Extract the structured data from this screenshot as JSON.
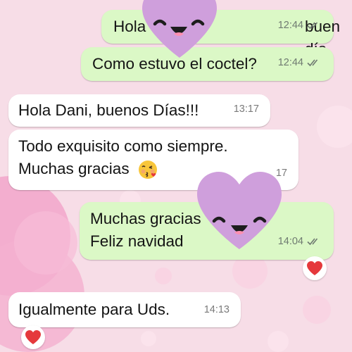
{
  "colors": {
    "background": "#f7dde7",
    "outgoing_bubble": "#dbf8c6",
    "incoming_bubble": "#ffffff",
    "meta_text": "#6f7a71",
    "sticker_heart": "#cf9fdc",
    "reaction_heart": "#e5393c"
  },
  "messages": [
    {
      "direction": "outgoing",
      "text": "Hola",
      "text_tail": "buen día",
      "time": "12:44",
      "status": "read-ticks-icon"
    },
    {
      "direction": "outgoing",
      "text": "Como estuvo el coctel?",
      "time": "12:44",
      "status": "read-ticks-icon"
    },
    {
      "direction": "incoming",
      "text": "Hola Dani, buenos Días!!!",
      "time": "13:17"
    },
    {
      "direction": "incoming",
      "text": "Todo exquisito como siempre.\nMuchas gracias",
      "emoji": "kissing-face-icon",
      "time": "17"
    },
    {
      "direction": "outgoing",
      "text": "Muchas gracias\nFeliz navidad",
      "time": "14:04",
      "status": "read-ticks-icon",
      "reaction": "heart-icon"
    },
    {
      "direction": "incoming",
      "text": "Igualmente para Uds.",
      "time": "14:13",
      "reaction": "heart-icon"
    }
  ],
  "stickers": [
    {
      "name": "heart-face-sticker-icon"
    },
    {
      "name": "heart-face-sticker-icon"
    }
  ]
}
